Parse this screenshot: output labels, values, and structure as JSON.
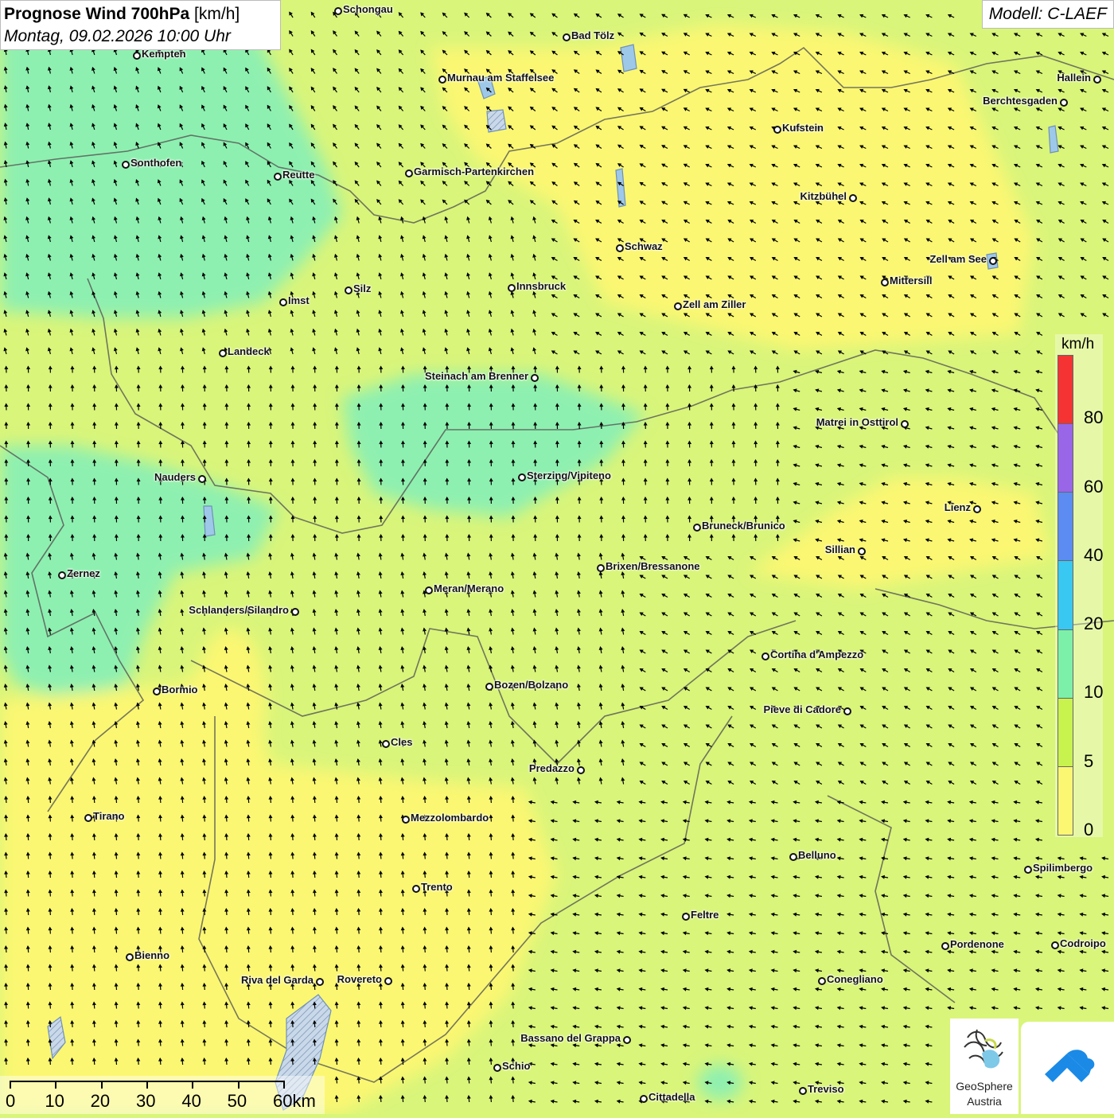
{
  "header": {
    "title_bold": "Prognose Wind 700hPa",
    "title_unit": "[km/h]",
    "datetime": "Montag, 09.02.2026 10:00 Uhr",
    "model": "Modell: C-LAEF"
  },
  "legend": {
    "unit": "km/h",
    "classes": [
      {
        "label": "80",
        "color": "#f53333"
      },
      {
        "label": "60",
        "color": "#9a66e8"
      },
      {
        "label": "40",
        "color": "#5c8cf2"
      },
      {
        "label": "20",
        "color": "#38c8f2"
      },
      {
        "label": "10",
        "color": "#7cf0a8"
      },
      {
        "label": "5",
        "color": "#c8f24e"
      },
      {
        "label": "0",
        "color": "#fbf772"
      }
    ]
  },
  "scalebar": {
    "labels": [
      "0",
      "10",
      "20",
      "30",
      "40",
      "50",
      "60km"
    ]
  },
  "logos": {
    "geosphere_line1": "GeoSphere",
    "geosphere_line2": "Austria"
  },
  "colors": {
    "calm": "#fbf772",
    "light": "#d9f57a",
    "moderate": "#8ef0b0",
    "border": "#555555",
    "lake": "#9ec8e8"
  },
  "cities": [
    {
      "name": "Schongau",
      "side": "right"
    },
    {
      "name": "Bad Tölz",
      "side": "right"
    },
    {
      "name": "Kempten",
      "side": "right"
    },
    {
      "name": "Murnau am Staffelsee",
      "side": "right"
    },
    {
      "name": "Hallein",
      "side": "left"
    },
    {
      "name": "Berchtesgaden",
      "side": "left"
    },
    {
      "name": "Kufstein",
      "side": "right"
    },
    {
      "name": "Sonthofen",
      "side": "right"
    },
    {
      "name": "Reutte",
      "side": "right"
    },
    {
      "name": "Garmisch-Partenkirchen",
      "side": "right"
    },
    {
      "name": "Kitzbühel",
      "side": "left"
    },
    {
      "name": "Schwaz",
      "side": "right"
    },
    {
      "name": "Zell am See",
      "side": "left"
    },
    {
      "name": "Mittersill",
      "side": "right"
    },
    {
      "name": "Silz",
      "side": "right"
    },
    {
      "name": "Innsbruck",
      "side": "right"
    },
    {
      "name": "Imst",
      "side": "right"
    },
    {
      "name": "Zell am Ziller",
      "side": "right"
    },
    {
      "name": "Landeck",
      "side": "right"
    },
    {
      "name": "Steinach am Brenner",
      "side": "left"
    },
    {
      "name": "Matrei in Osttirol",
      "side": "left"
    },
    {
      "name": "Nauders",
      "side": "left"
    },
    {
      "name": "Sterzing/Vipiteno",
      "side": "right"
    },
    {
      "name": "Lienz",
      "side": "left"
    },
    {
      "name": "Bruneck/Brunico",
      "side": "right"
    },
    {
      "name": "Sillian",
      "side": "left"
    },
    {
      "name": "Brixen/Bressanone",
      "side": "right"
    },
    {
      "name": "Zernez",
      "side": "right"
    },
    {
      "name": "Meran/Merano",
      "side": "right"
    },
    {
      "name": "Schlanders/Silandro",
      "side": "left"
    },
    {
      "name": "Cortina d'Ampezzo",
      "side": "right"
    },
    {
      "name": "Bozen/Bolzano",
      "side": "right"
    },
    {
      "name": "Bormio",
      "side": "right"
    },
    {
      "name": "Pieve di Cadore",
      "side": "left"
    },
    {
      "name": "Cles",
      "side": "right"
    },
    {
      "name": "Predazzo",
      "side": "left"
    },
    {
      "name": "Tirano",
      "side": "right"
    },
    {
      "name": "Mezzolombardo",
      "side": "right"
    },
    {
      "name": "Belluno",
      "side": "right"
    },
    {
      "name": "Spilimbergo",
      "side": "right"
    },
    {
      "name": "Trento",
      "side": "right"
    },
    {
      "name": "Feltre",
      "side": "right"
    },
    {
      "name": "Pordenone",
      "side": "right"
    },
    {
      "name": "Codroipo",
      "side": "right"
    },
    {
      "name": "Bienno",
      "side": "right"
    },
    {
      "name": "Riva del Garda",
      "side": "left"
    },
    {
      "name": "Rovereto",
      "side": "left"
    },
    {
      "name": "Conegliano",
      "side": "right"
    },
    {
      "name": "Bassano del Grappa",
      "side": "left"
    },
    {
      "name": "Schio",
      "side": "right"
    },
    {
      "name": "Treviso",
      "side": "right"
    },
    {
      "name": "Cittadella",
      "side": "right"
    }
  ]
}
